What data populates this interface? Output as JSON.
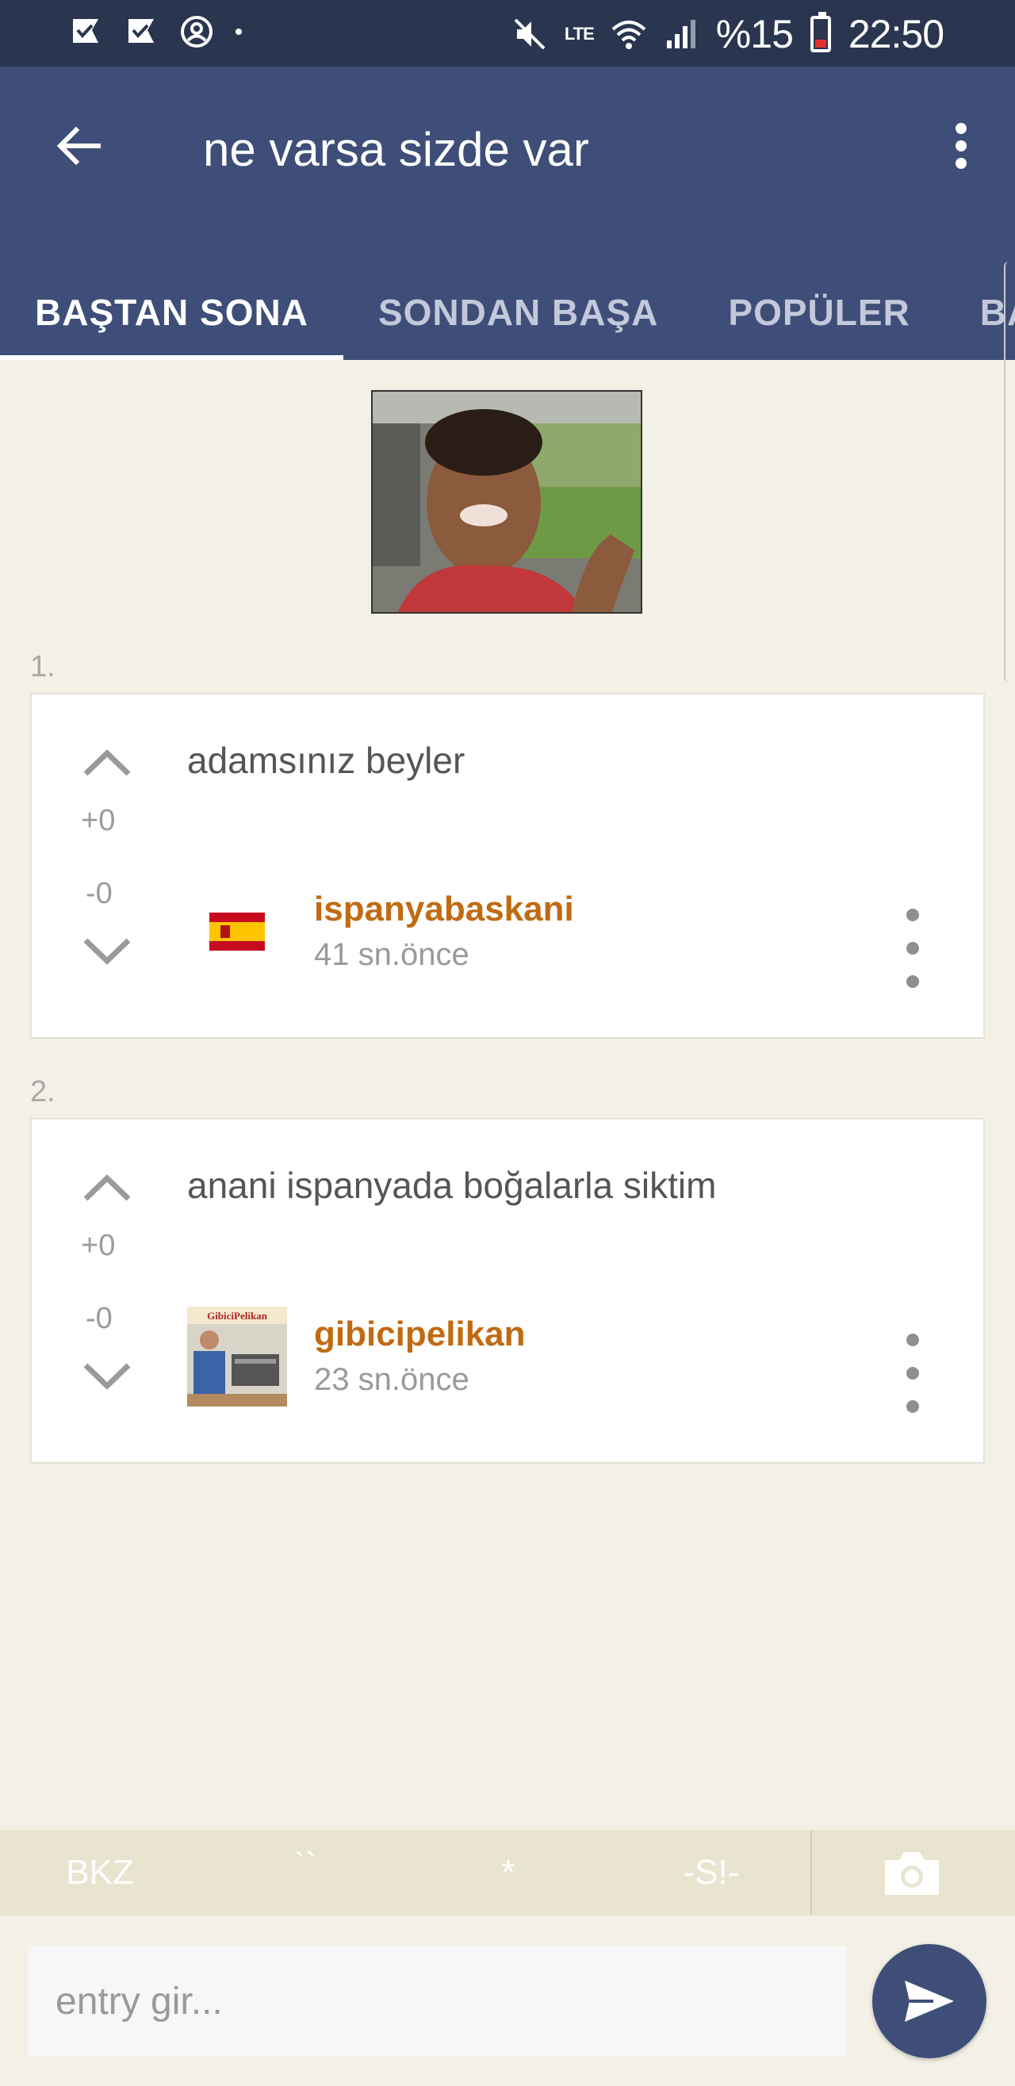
{
  "status_bar": {
    "battery": "%15",
    "time": "22:50",
    "network": "LTE"
  },
  "app_bar": {
    "title": "ne varsa sizde var",
    "back_icon": "arrow-left-icon",
    "menu_icon": "more-vertical-icon",
    "background_color": "#3e4e78"
  },
  "tabs": [
    {
      "label": "BAŞTAN SONA",
      "active": true
    },
    {
      "label": "SONDAN BAŞA",
      "active": false
    },
    {
      "label": "POPÜLER",
      "active": false
    },
    {
      "label": "BAŞ",
      "active": false
    }
  ],
  "entries": [
    {
      "number": "1.",
      "text": "adamsınız beyler",
      "upvotes": "+0",
      "downvotes": "-0",
      "author": "ispanyabaskani",
      "time": "41 sn.önce",
      "avatar": "spain-flag"
    },
    {
      "number": "2.",
      "text": "anani ispanyada boğalarla siktim",
      "upvotes": "+0",
      "downvotes": "-0",
      "author": "gibicipelikan",
      "time": "23 sn.önce",
      "avatar": "GibiciPelikan"
    }
  ],
  "format_bar": {
    "bkz": "BKZ",
    "backticks": "``",
    "star": "*",
    "spoiler": "-S!-",
    "camera_icon": "camera-icon"
  },
  "composer": {
    "placeholder": "entry gir...",
    "send_icon": "send-icon"
  },
  "colors": {
    "accent": "#3e4e78",
    "author": "#c06b12",
    "background": "#f3f1e6"
  }
}
